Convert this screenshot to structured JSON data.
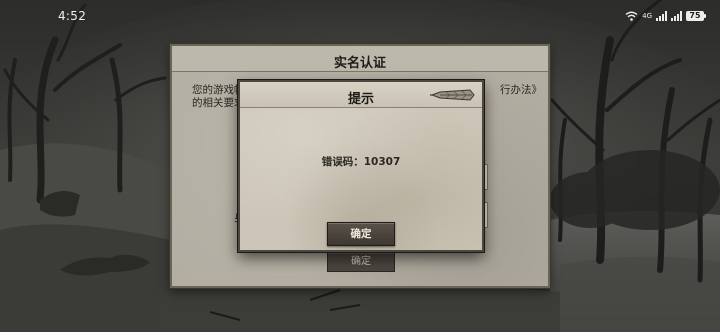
{
  "status_bar": {
    "time": "4:52",
    "network_tag": "4G",
    "battery": "75"
  },
  "back_dialog": {
    "title": "实名认证",
    "text_line1": "您的游戏帐",
    "text_line1_end": "行办法》",
    "text_line2": "的相关要求",
    "text_line2_end": "。",
    "field_label": "身",
    "confirm_label": "确定"
  },
  "alert_dialog": {
    "title": "提示",
    "message": "错误码：10307",
    "confirm_label": "确定"
  },
  "colors": {
    "panel_parchment": "#cdc6b8",
    "button_dark": "#4c4640",
    "frame_dark": "#4d483f"
  }
}
